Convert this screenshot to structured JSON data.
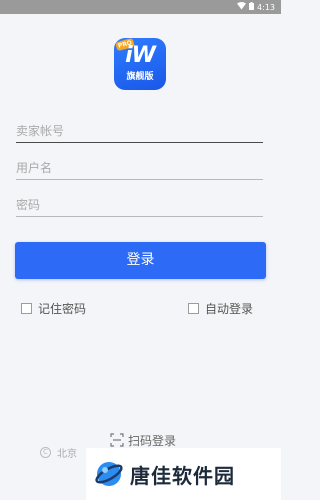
{
  "status_bar": {
    "time": "4:13",
    "icons": [
      "wifi-icon",
      "battery-icon"
    ]
  },
  "app_logo": {
    "mark": "iW",
    "text": "旗舰版",
    "badge": "PRO"
  },
  "form": {
    "seller_account_placeholder": "卖家帐号",
    "username_placeholder": "用户名",
    "password_placeholder": "密码"
  },
  "login_button": {
    "label": "登录"
  },
  "options": {
    "remember_password": "记住密码",
    "auto_login": "自动登录"
  },
  "scan_login": {
    "label": "扫码登录"
  },
  "footer": {
    "text": "北京"
  },
  "watermark": {
    "text": "唐佳软件园"
  },
  "colors": {
    "primary": "#2d6bf7",
    "background": "#f4f5f8",
    "status_bar": "#9a9a9a"
  }
}
